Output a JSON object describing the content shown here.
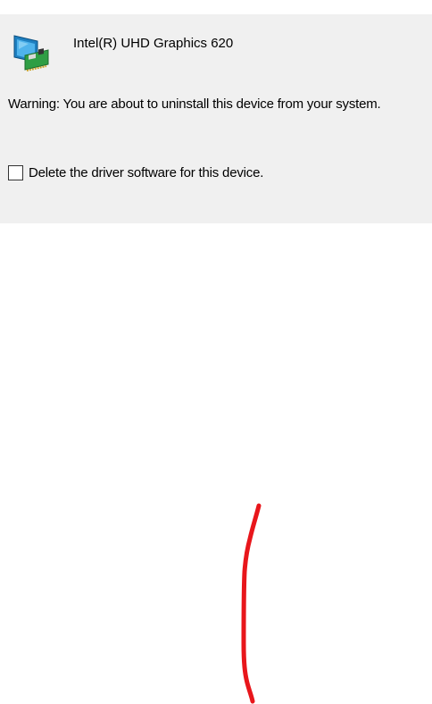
{
  "dialog": {
    "device_name": "Intel(R) UHD Graphics 620",
    "device_icon": "display-adapter-icon",
    "warning": "Warning: You are about to uninstall this device from your system.",
    "delete_driver": {
      "label": "Delete the driver software for this device.",
      "checked": false
    }
  },
  "annotation": {
    "type": "hand-drawn-line",
    "color": "#e8161b"
  }
}
